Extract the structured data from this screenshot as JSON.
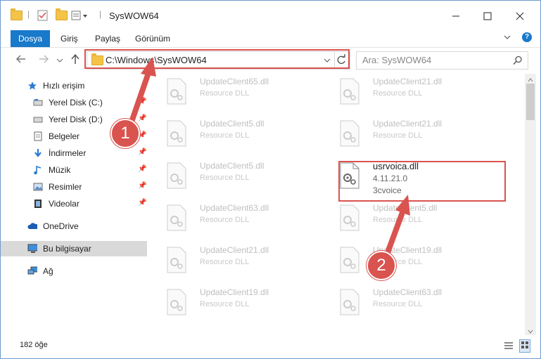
{
  "window": {
    "title": "SysWOW64"
  },
  "ribbon": {
    "tabs": [
      "Dosya",
      "Giriş",
      "Paylaş",
      "Görünüm"
    ]
  },
  "address": {
    "path": "C:\\Windows\\SysWOW64"
  },
  "search": {
    "placeholder": "Ara: SysWOW64"
  },
  "sidebar": {
    "items": [
      {
        "label": "Hızlı erişim",
        "icon": "star-icon"
      },
      {
        "label": "Yerel Disk (C:)",
        "icon": "drive-icon"
      },
      {
        "label": "Yerel Disk (D:)",
        "icon": "drive-icon"
      },
      {
        "label": "Belgeler",
        "icon": "document-icon"
      },
      {
        "label": "İndirmeler",
        "icon": "download-icon"
      },
      {
        "label": "Müzik",
        "icon": "music-icon"
      },
      {
        "label": "Resimler",
        "icon": "pictures-icon"
      },
      {
        "label": "Videolar",
        "icon": "video-icon"
      },
      {
        "label": "OneDrive",
        "icon": "cloud-icon"
      },
      {
        "label": "Bu bilgisayar",
        "icon": "computer-icon"
      },
      {
        "label": "Ağ",
        "icon": "network-icon"
      }
    ]
  },
  "files": [
    {
      "name": "UpdateClient65.dll",
      "type": "Resource DLL"
    },
    {
      "name": "UpdateClient21.dll",
      "type": "Resource DLL"
    },
    {
      "name": "UpdateClient5.dll",
      "type": "Resource DLL"
    },
    {
      "name": "UpdateClient21.dll",
      "type": "Resource DLL"
    },
    {
      "name": "UpdateClient5.dll",
      "type": "Resource DLL"
    },
    {
      "name": "usrvoica.dll",
      "version": "4.11.21.0",
      "company": "3cvoice"
    },
    {
      "name": "UpdateClient63.dll",
      "type": "Resource DLL"
    },
    {
      "name": "UpdateClient5.dll",
      "type": "Resource DLL"
    },
    {
      "name": "UpdateClient21.dll",
      "type": "Resource DLL"
    },
    {
      "name": "UpdateClient19.dll",
      "type": "Resource DLL"
    },
    {
      "name": "UpdateClient19.dll",
      "type": "Resource DLL"
    },
    {
      "name": "UpdateClient63.dll",
      "type": "Resource DLL"
    }
  ],
  "status": {
    "count": "182 öğe"
  },
  "annotations": {
    "step1": "1",
    "step2": "2"
  },
  "colors": {
    "accent": "#1979ca",
    "highlight": "#d9534f"
  }
}
